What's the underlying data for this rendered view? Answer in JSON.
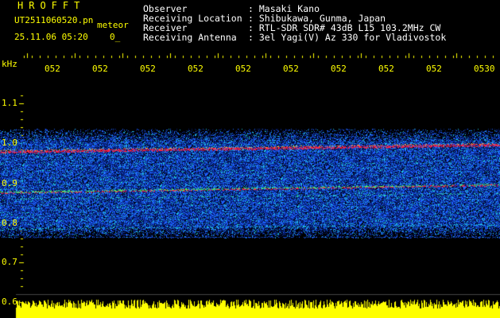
{
  "app": {
    "brand": "HROFFT",
    "file_name": "UT2511060520.pn",
    "mode_label": "meteor",
    "timestamp": "25.11.06 05:20",
    "timestamp_suffix": "0_"
  },
  "header": {
    "rows": [
      {
        "label": "Observer",
        "value": ": Masaki Kano"
      },
      {
        "label": "Receiving Location",
        "value": ": Shibukawa, Gunma, Japan"
      },
      {
        "label": "Receiver",
        "value": ": RTL-SDR SDR# 43dB L15 103.2MHz CW"
      },
      {
        "label": "Receiving Antenna",
        "value": ": 3el Yagi(V) Az 330 for Vladivostok"
      }
    ]
  },
  "axis": {
    "unit": "kHz",
    "y_ticks": [
      "1.1",
      "1.0",
      "0.9",
      "0.8",
      "0.7",
      "0.6"
    ],
    "x_ticks": [
      "052",
      "052",
      "052",
      "052",
      "052",
      "052",
      "052",
      "052",
      "052",
      "0530"
    ]
  },
  "colors": {
    "text_yellow": "#ffff00",
    "text_white": "#ffffff",
    "background": "#000000",
    "noise_dark": "#06207a",
    "noise_mid": "#1e62ff",
    "noise_cyan": "#20c8e0",
    "echo_red": "#ff2040",
    "power_bar": "#ffff00"
  }
}
